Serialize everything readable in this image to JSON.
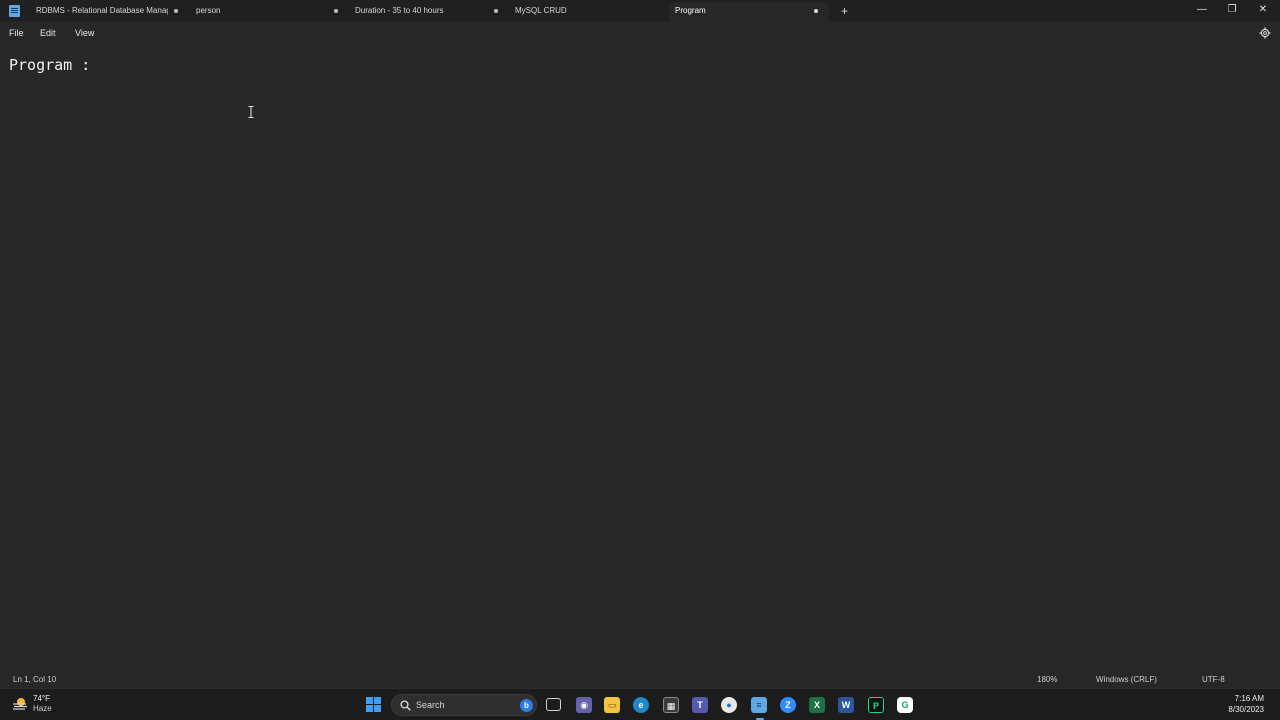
{
  "window": {
    "tabs": [
      {
        "label": "RDBMS - Relational Database Manag",
        "unsaved": true
      },
      {
        "label": "person",
        "unsaved": true
      },
      {
        "label": "Duration - 35 to 40 hours",
        "unsaved": true
      },
      {
        "label": "MySQL CRUD",
        "unsaved": false
      },
      {
        "label": "Program",
        "unsaved": true,
        "active": true
      }
    ],
    "new_tab_symbol": "+",
    "controls": {
      "minimize": "—",
      "restore": "❐",
      "close": "✕"
    }
  },
  "menu": {
    "items": [
      "File",
      "Edit",
      "View"
    ],
    "settings_icon": "gear-icon"
  },
  "editor": {
    "content": "Program :"
  },
  "status": {
    "position": "Ln 1, Col 10",
    "zoom": "180%",
    "line_ending": "Windows (CRLF)",
    "encoding": "UTF-8"
  },
  "taskbar": {
    "weather": {
      "temp": "74°F",
      "condition": "Haze"
    },
    "search_label": "Search",
    "apps": [
      "task-view-icon",
      "teams-chat-icon",
      "file-explorer-icon",
      "edge-icon",
      "store-icon",
      "teams-icon",
      "chrome-icon",
      "notepad-icon",
      "zoom-icon",
      "excel-icon",
      "word-icon",
      "pycharm-icon",
      "grammarly-icon"
    ],
    "time": "7:16 AM",
    "date": "8/30/2023"
  },
  "colors": {
    "background": "#272727",
    "titlebar": "#202020",
    "taskbar": "#1c1c1c",
    "accent": "#3ea0f5"
  }
}
